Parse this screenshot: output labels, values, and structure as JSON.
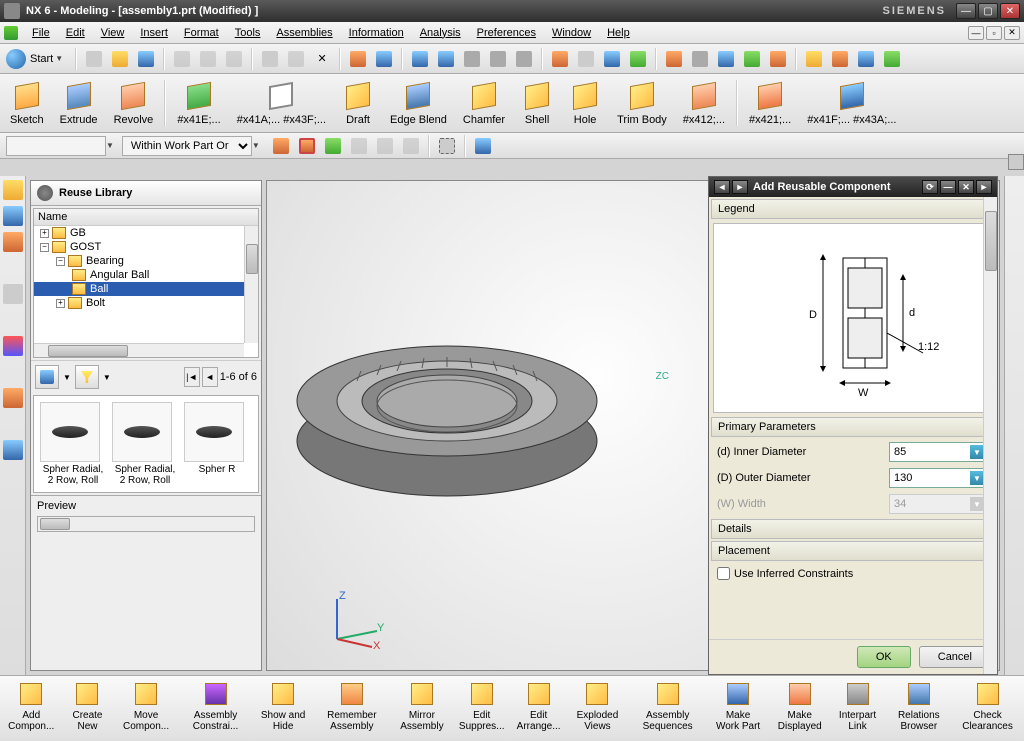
{
  "window": {
    "title": "NX 6 - Modeling - [assembly1.prt (Modified) ]",
    "brand": "SIEMENS"
  },
  "menubar": [
    "File",
    "Edit",
    "View",
    "Insert",
    "Format",
    "Tools",
    "Assemblies",
    "Information",
    "Analysis",
    "Preferences",
    "Window",
    "Help"
  ],
  "start_label": "Start",
  "filter_combo": "Within Work Part Or",
  "ribbon": {
    "sketch": "Sketch",
    "extrude": "Extrude",
    "revolve": "Revolve",
    "x41e": "#x41E;...",
    "x41a": "#x41A;...\n#x43F;...",
    "draft": "Draft",
    "edgeblend": "Edge Blend",
    "chamfer": "Chamfer",
    "shell": "Shell",
    "hole": "Hole",
    "trimbody": "Trim Body",
    "x412": "#x412;...",
    "x421": "#x421;...",
    "x41f": "#x41F;...\n#x43A;..."
  },
  "reuse": {
    "title": "Reuse Library",
    "col": "Name",
    "tree": {
      "gb": "GB",
      "gost": "GOST",
      "bearing": "Bearing",
      "angular": "Angular Ball",
      "ball": "Ball",
      "bolt": "Bolt"
    },
    "pager": "1-6 of 6",
    "thumb1": "Spher Radial, 2 Row, Roll",
    "thumb2": "Spher Radial, 2 Row, Roll",
    "thumb3": "Spher R",
    "preview": "Preview"
  },
  "arc": {
    "title": "Add Reusable Component",
    "legend": "Legend",
    "primary": "Primary Parameters",
    "p_inner": "(d) Inner Diameter",
    "p_inner_v": "85",
    "p_outer": "(D) Outer Diameter",
    "p_outer_v": "130",
    "p_width": "(W) Width",
    "p_width_v": "34",
    "details": "Details",
    "placement": "Placement",
    "use_inferred": "Use Inferred Constraints",
    "ok": "OK",
    "cancel": "Cancel",
    "diag_D": "D",
    "diag_d": "d",
    "diag_W": "W",
    "diag_ratio": "1:12"
  },
  "bottom": [
    "Add Compon...",
    "Create New",
    "Move Compon...",
    "Assembly Constrai...",
    "Show and Hide",
    "Remember Assembly",
    "Mirror Assembly",
    "Edit Suppres...",
    "Edit Arrange...",
    "Exploded Views",
    "Assembly Sequences",
    "Make Work Part",
    "Make Displayed",
    "Interpart Link",
    "Relations Browser",
    "Check Clearances"
  ],
  "axis": {
    "x": "X",
    "y": "Y",
    "z": "Z"
  },
  "zc": "ZC"
}
